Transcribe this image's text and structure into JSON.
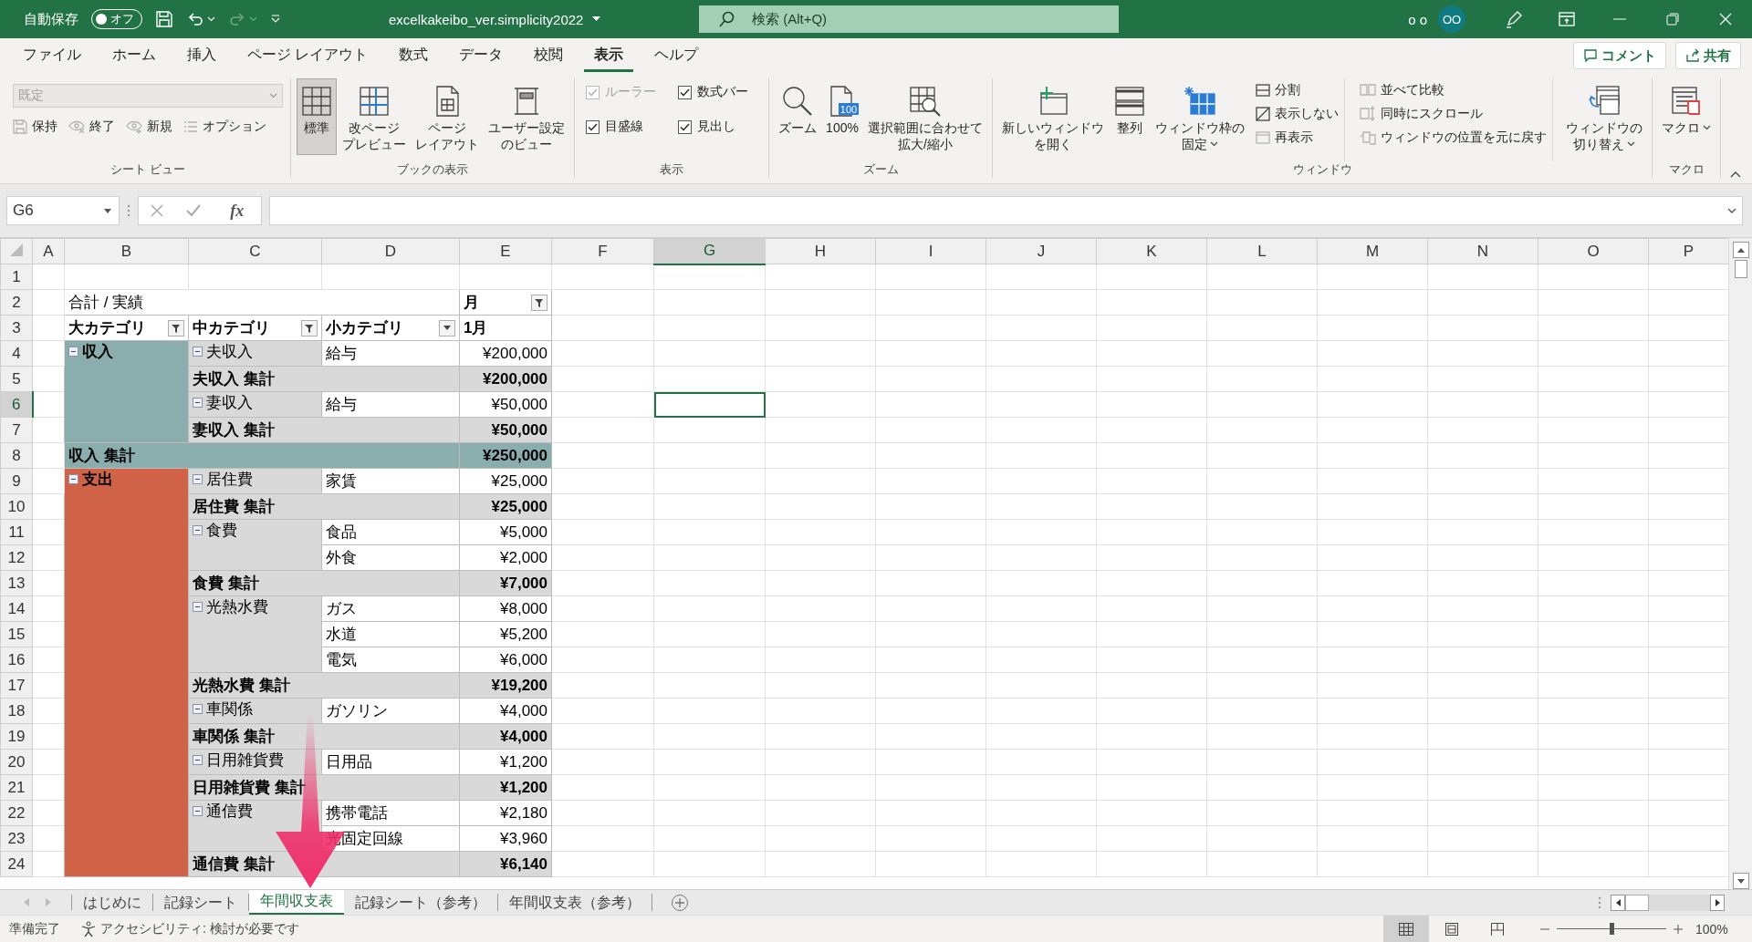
{
  "title_bar": {
    "autosave_label": "自動保存",
    "autosave": {
      "label": "オフ",
      "on": false
    },
    "filename": "excelkakeibo_ver.simplicity2022",
    "search": {
      "placeholder": "検索 (Alt+Q)"
    },
    "user_name": "o o",
    "avatar": "OO"
  },
  "menu_tabs": [
    {
      "label": "ファイル",
      "selected": false
    },
    {
      "label": "ホーム",
      "selected": false
    },
    {
      "label": "挿入",
      "selected": false
    },
    {
      "label": "ページ レイアウト",
      "selected": false
    },
    {
      "label": "数式",
      "selected": false
    },
    {
      "label": "データ",
      "selected": false
    },
    {
      "label": "校閲",
      "selected": false
    },
    {
      "label": "表示",
      "selected": true
    },
    {
      "label": "ヘルプ",
      "selected": false
    }
  ],
  "comment_button": "コメント",
  "share_button": "共有",
  "ribbon": {
    "groups": [
      {
        "label": "シート ビュー",
        "items": [
          {
            "kind": "dropdown",
            "value": "既定",
            "disabled": true
          },
          {
            "kind": "row",
            "items": [
              {
                "kind": "small",
                "label": "保持",
                "disabled": true
              },
              {
                "kind": "small",
                "label": "終了",
                "disabled": true
              },
              {
                "kind": "small",
                "label": "新規",
                "disabled": true
              },
              {
                "kind": "small",
                "label": "オプション",
                "disabled": true
              }
            ]
          }
        ]
      },
      {
        "label": "ブックの表示",
        "items": [
          {
            "kind": "big",
            "label": "標準",
            "selected": true,
            "disabled": false
          },
          {
            "kind": "big",
            "label_lines": [
              "改ページ",
              "プレビュー"
            ],
            "selected": false,
            "disabled": false
          },
          {
            "kind": "big",
            "label_lines": [
              "ページ",
              "レイアウト"
            ],
            "selected": false,
            "disabled": false
          },
          {
            "kind": "big",
            "label_lines": [
              "ユーザー設定",
              "のビュー"
            ],
            "selected": false,
            "disabled": false
          }
        ]
      },
      {
        "label": "表示",
        "items": [
          {
            "kind": "stack",
            "items": [
              {
                "kind": "check",
                "label": "ルーラー",
                "checked": true,
                "disabled": true
              },
              {
                "kind": "check",
                "label": "目盛線",
                "checked": true,
                "disabled": false
              }
            ]
          },
          {
            "kind": "stack",
            "items": [
              {
                "kind": "check",
                "label": "数式バー",
                "checked": true,
                "disabled": false
              },
              {
                "kind": "check",
                "label": "見出し",
                "checked": true,
                "disabled": false
              }
            ]
          }
        ]
      },
      {
        "label": "ズーム",
        "items": [
          {
            "kind": "big",
            "label": "ズーム",
            "selected": false,
            "disabled": false
          },
          {
            "kind": "big",
            "label": "100%",
            "badge": "100",
            "selected": false,
            "disabled": false
          },
          {
            "kind": "big",
            "label_lines": [
              "選択範囲に合わせて",
              "拡大/縮小"
            ],
            "selected": false,
            "disabled": false
          }
        ]
      },
      {
        "label": "ウィンドウ",
        "items": [
          {
            "kind": "big",
            "label_lines": [
              "新しいウィンドウ",
              "を開く"
            ],
            "selected": false,
            "disabled": false
          },
          {
            "kind": "big",
            "label": "整列",
            "selected": false,
            "disabled": false
          },
          {
            "kind": "big",
            "label_lines": [
              "ウィンドウ枠の",
              "固定"
            ],
            "has_menu": true,
            "selected": false,
            "disabled": false
          },
          {
            "kind": "stack",
            "items": [
              {
                "kind": "small",
                "label": "分割",
                "disabled": false
              },
              {
                "kind": "small",
                "label": "表示しない",
                "disabled": false
              },
              {
                "kind": "small",
                "label": "再表示",
                "disabled": true
              }
            ]
          },
          {
            "kind": "stack",
            "items": [
              {
                "kind": "small",
                "label": "並べて比較",
                "disabled": true
              },
              {
                "kind": "small",
                "label": "同時にスクロール",
                "disabled": true
              },
              {
                "kind": "small",
                "label": "ウィンドウの位置を元に戻す",
                "disabled": true
              }
            ]
          },
          {
            "kind": "big",
            "label_lines": [
              "ウィンドウの",
              "切り替え"
            ],
            "has_menu": true,
            "selected": false,
            "disabled": false
          }
        ]
      },
      {
        "label": "マクロ",
        "items": [
          {
            "kind": "big",
            "label": "マクロ",
            "has_menu": true,
            "selected": false,
            "disabled": false
          }
        ]
      }
    ]
  },
  "formula_bar": {
    "name_box": "G6",
    "function_button": "fx"
  },
  "sheet": {
    "columns": [
      {
        "label": "A",
        "selected": false
      },
      {
        "label": "B",
        "selected": false
      },
      {
        "label": "C",
        "selected": false
      },
      {
        "label": "D",
        "selected": false
      },
      {
        "label": "E",
        "selected": false
      },
      {
        "label": "F",
        "selected": false
      },
      {
        "label": "G",
        "selected": true
      },
      {
        "label": "H",
        "selected": false
      },
      {
        "label": "I",
        "selected": false
      },
      {
        "label": "J",
        "selected": false
      },
      {
        "label": "K",
        "selected": false
      },
      {
        "label": "L",
        "selected": false
      },
      {
        "label": "M",
        "selected": false
      },
      {
        "label": "N",
        "selected": false
      },
      {
        "label": "O",
        "selected": false
      },
      {
        "label": "P",
        "selected": false
      }
    ],
    "rows": [
      {
        "label": "1",
        "selected": false
      },
      {
        "label": "2",
        "selected": false
      },
      {
        "label": "3",
        "selected": false
      },
      {
        "label": "4",
        "selected": false
      },
      {
        "label": "5",
        "selected": false
      },
      {
        "label": "6",
        "selected": true
      },
      {
        "label": "7",
        "selected": false
      },
      {
        "label": "8",
        "selected": false
      },
      {
        "label": "9",
        "selected": false
      },
      {
        "label": "10",
        "selected": false
      },
      {
        "label": "11",
        "selected": false
      },
      {
        "label": "12",
        "selected": false
      },
      {
        "label": "13",
        "selected": false
      },
      {
        "label": "14",
        "selected": false
      },
      {
        "label": "15",
        "selected": false
      },
      {
        "label": "16",
        "selected": false
      },
      {
        "label": "17",
        "selected": false
      },
      {
        "label": "18",
        "selected": false
      },
      {
        "label": "19",
        "selected": false
      },
      {
        "label": "20",
        "selected": false
      },
      {
        "label": "21",
        "selected": false
      },
      {
        "label": "22",
        "selected": false
      },
      {
        "label": "23",
        "selected": false
      },
      {
        "label": "24",
        "selected": false
      }
    ]
  },
  "pivot": {
    "title": "合計 / 実績",
    "column_field": {
      "label": "月",
      "filtered": true
    },
    "headers": [
      {
        "label": "大カテゴリ",
        "filtered": true
      },
      {
        "label": "中カテゴリ",
        "filtered": true
      },
      {
        "label": "小カテゴリ",
        "filtered": false
      }
    ],
    "column_item": "1月",
    "groups": [
      {
        "label": "収入",
        "color": "#8aadad",
        "expanded": true,
        "subgroups": [
          {
            "label": "夫収入",
            "expanded": true,
            "items": [
              {
                "name": "給与",
                "value": "¥200,000"
              }
            ],
            "total_label": "夫収入 集計",
            "total": "¥200,000"
          },
          {
            "label": "妻収入",
            "expanded": true,
            "items": [
              {
                "name": "給与",
                "value": "¥50,000"
              }
            ],
            "total_label": "妻収入 集計",
            "total": "¥50,000"
          }
        ],
        "total_label": "収入 集計",
        "total": "¥250,000"
      },
      {
        "label": "支出",
        "color": "#d06347",
        "expanded": true,
        "subgroups": [
          {
            "label": "居住費",
            "expanded": true,
            "items": [
              {
                "name": "家賃",
                "value": "¥25,000"
              }
            ],
            "total_label": "居住費 集計",
            "total": "¥25,000"
          },
          {
            "label": "食費",
            "expanded": true,
            "items": [
              {
                "name": "食品",
                "value": "¥5,000"
              },
              {
                "name": "外食",
                "value": "¥2,000"
              }
            ],
            "total_label": "食費 集計",
            "total": "¥7,000"
          },
          {
            "label": "光熱水費",
            "expanded": true,
            "items": [
              {
                "name": "ガス",
                "value": "¥8,000"
              },
              {
                "name": "水道",
                "value": "¥5,200"
              },
              {
                "name": "電気",
                "value": "¥6,000"
              }
            ],
            "total_label": "光熱水費 集計",
            "total": "¥19,200"
          },
          {
            "label": "車関係",
            "expanded": true,
            "items": [
              {
                "name": "ガソリン",
                "value": "¥4,000"
              }
            ],
            "total_label": "車関係 集計",
            "total": "¥4,000"
          },
          {
            "label": "日用雑貨費",
            "expanded": true,
            "items": [
              {
                "name": "日用品",
                "value": "¥1,200"
              }
            ],
            "total_label": "日用雑貨費 集計",
            "total": "¥1,200"
          },
          {
            "label": "通信費",
            "expanded": true,
            "items": [
              {
                "name": "携帯電話",
                "value": "¥2,180"
              },
              {
                "name": "光固定回線",
                "value": "¥3,960"
              }
            ],
            "total_label": "通信費 集計",
            "total": "¥6,140"
          }
        ]
      }
    ]
  },
  "sheet_tabs": [
    {
      "label": "はじめに",
      "selected": false
    },
    {
      "label": "記録シート",
      "selected": false
    },
    {
      "label": "年間収支表",
      "selected": true
    },
    {
      "label": "記録シート（参考）",
      "selected": false
    },
    {
      "label": "年間収支表（参考）",
      "selected": false
    }
  ],
  "status_bar": {
    "status": "準備完了",
    "accessibility": "アクセシビリティ: 検討が必要です",
    "views": [
      {
        "kind": "normal",
        "selected": true
      },
      {
        "kind": "page_layout",
        "selected": false
      },
      {
        "kind": "page_break",
        "selected": false
      }
    ],
    "zoom": {
      "level": 0.5
    },
    "zoom_label": "100%"
  },
  "annotation": {
    "kind": "arrow"
  }
}
